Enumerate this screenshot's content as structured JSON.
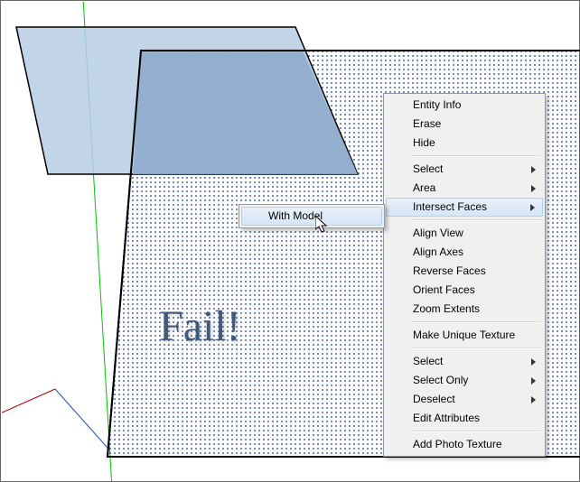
{
  "annotation": "Fail!",
  "menu": {
    "items": [
      {
        "label": "Entity Info",
        "sub": false
      },
      {
        "label": "Erase",
        "sub": false
      },
      {
        "label": "Hide",
        "sub": false
      },
      "---",
      {
        "label": "Select",
        "sub": true
      },
      {
        "label": "Area",
        "sub": true
      },
      {
        "label": "Intersect Faces",
        "sub": true,
        "highlight": true
      },
      "---",
      {
        "label": "Align View",
        "sub": false
      },
      {
        "label": "Align Axes",
        "sub": false
      },
      {
        "label": "Reverse Faces",
        "sub": false
      },
      {
        "label": "Orient Faces",
        "sub": false
      },
      {
        "label": "Zoom Extents",
        "sub": false
      },
      "---",
      {
        "label": "Make Unique Texture",
        "sub": false
      },
      "---",
      {
        "label": "Select",
        "sub": true
      },
      {
        "label": "Select Only",
        "sub": true
      },
      {
        "label": "Deselect",
        "sub": true
      },
      {
        "label": "Edit Attributes",
        "sub": false
      },
      "---",
      {
        "label": "Add Photo Texture",
        "sub": false
      }
    ]
  },
  "submenu": {
    "parent": "Intersect Faces",
    "items": [
      {
        "label": "With Model",
        "highlight": true
      }
    ]
  },
  "colors": {
    "selected_fill": "#9db9d9",
    "face_dots": "#1a3a80",
    "axis_green": "#00c000",
    "axis_red": "#b00000",
    "shape_edge": "#000000"
  }
}
